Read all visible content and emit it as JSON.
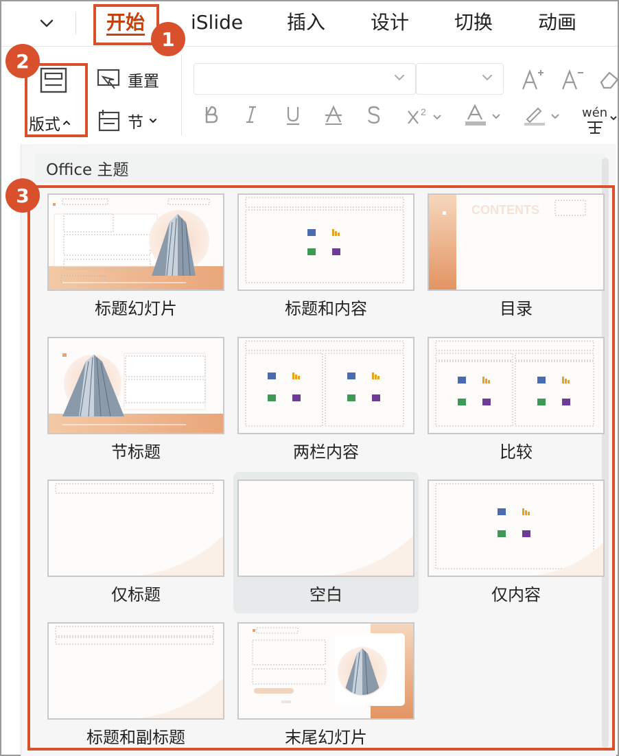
{
  "tabs": [
    {
      "label": "开始",
      "active": true
    },
    {
      "label": "iSlide",
      "active": false
    },
    {
      "label": "插入",
      "active": false
    },
    {
      "label": "设计",
      "active": false
    },
    {
      "label": "切换",
      "active": false
    },
    {
      "label": "动画",
      "active": false
    }
  ],
  "ribbon": {
    "layout_label": "版式",
    "reset_label": "重置",
    "section_label": "节",
    "phonetic_label": "wén"
  },
  "panel": {
    "title": "Office 主题",
    "layouts": [
      {
        "label": "标题幻灯片",
        "selected": false
      },
      {
        "label": "标题和内容",
        "selected": false
      },
      {
        "label": "目录",
        "selected": false
      },
      {
        "label": "节标题",
        "selected": false
      },
      {
        "label": "两栏内容",
        "selected": false
      },
      {
        "label": "比较",
        "selected": false
      },
      {
        "label": "仅标题",
        "selected": false
      },
      {
        "label": "空白",
        "selected": true
      },
      {
        "label": "仅内容",
        "selected": false
      },
      {
        "label": "标题和副标题",
        "selected": false
      },
      {
        "label": "末尾幻灯片",
        "selected": false
      }
    ],
    "thumbnail_watermark": "CONTENTS"
  },
  "annotations": [
    "1",
    "2",
    "3"
  ],
  "colors": {
    "accent": "#c4410c",
    "annotation": "#d9502c",
    "thumb_orange": "#e8a070"
  }
}
